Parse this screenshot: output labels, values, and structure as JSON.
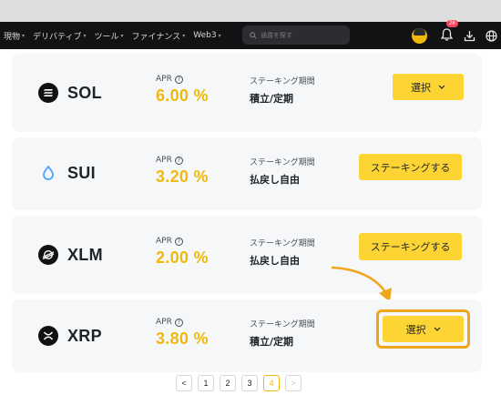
{
  "nav": {
    "items": [
      {
        "label": "現物",
        "caret": "▾"
      },
      {
        "label": "デリバティブ",
        "caret": "▾"
      },
      {
        "label": "ツール",
        "caret": "▾"
      },
      {
        "label": "ファイナンス",
        "caret": "▾"
      },
      {
        "label": "Web3",
        "caret": "▾"
      }
    ],
    "search_placeholder": "通貨を探す",
    "notification_count": "28"
  },
  "products": [
    {
      "coin": "SOL",
      "icon": "solana-icon",
      "apr_label": "APR",
      "apr": "6.00 %",
      "term_label": "ステーキング期間",
      "term": "積立/定期",
      "button": "選択",
      "button_type": "select"
    },
    {
      "coin": "SUI",
      "icon": "sui-icon",
      "apr_label": "APR",
      "apr": "3.20 %",
      "term_label": "ステーキング期間",
      "term": "払戻し自由",
      "button": "ステーキングする",
      "button_type": "stake"
    },
    {
      "coin": "XLM",
      "icon": "stellar-icon",
      "apr_label": "APR",
      "apr": "2.00 %",
      "term_label": "ステーキング期間",
      "term": "払戻し自由",
      "button": "ステーキングする",
      "button_type": "stake"
    },
    {
      "coin": "XRP",
      "icon": "xrp-icon",
      "apr_label": "APR",
      "apr": "3.80 %",
      "term_label": "ステーキング期間",
      "term": "積立/定期",
      "button": "選択",
      "button_type": "select"
    }
  ],
  "pagination": {
    "prev": "<",
    "pages": [
      "1",
      "2",
      "3",
      "4"
    ],
    "current": "4",
    "next": ">"
  },
  "colors": {
    "accent": "#fcd535",
    "apr": "#f0b90b",
    "highlight": "#f0a51a",
    "topbar": "#111214"
  }
}
